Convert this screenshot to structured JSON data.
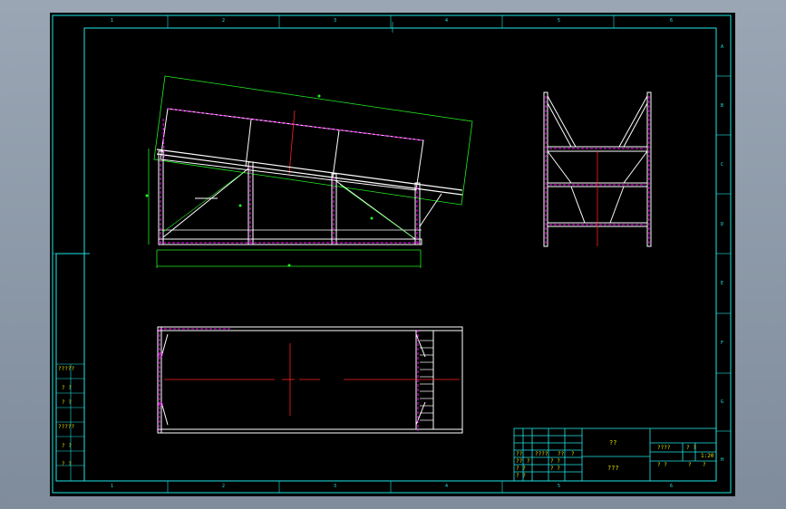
{
  "colors": {
    "background": "#000000",
    "frame": "#21e6e6",
    "outline": "#ffffff",
    "centerline": "#ff2020",
    "hidden": "#ff00ff",
    "dimension": "#22ee22",
    "title_text": "#e0e000"
  },
  "grid": {
    "columns": [
      "1",
      "2",
      "3",
      "4",
      "5",
      "6"
    ],
    "rows": [
      "A",
      "B",
      "C",
      "D",
      "E",
      "F",
      "G",
      "H"
    ]
  },
  "left_strip": [
    "?????",
    "? ?",
    "? ?",
    "?????",
    "? ?",
    "? ?"
  ],
  "title_block": {
    "name": "??",
    "material": "???",
    "cells": {
      "a": "????",
      "b": "??",
      "c": "??",
      "d": "?",
      "e": "??",
      "f": "?",
      "g": "? ?",
      "h": "? ?",
      "i": "? ?",
      "j": "? ?",
      "k": "????",
      "l": "? ?",
      "m": "1:20",
      "n": "? ?",
      "o": "?",
      "p": "?"
    }
  }
}
